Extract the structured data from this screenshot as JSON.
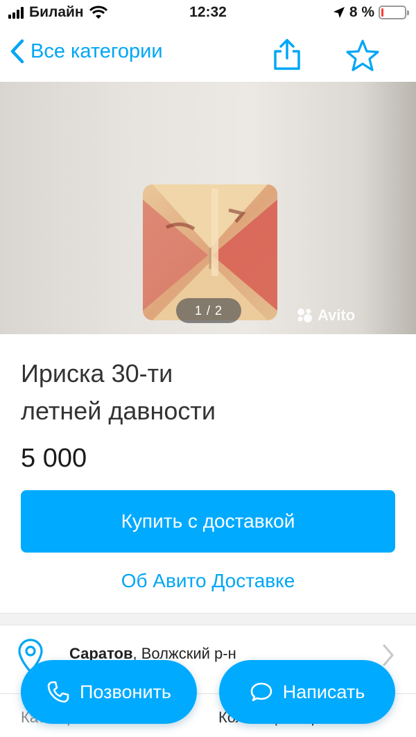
{
  "status_bar": {
    "carrier": "Билайн",
    "time": "12:32",
    "battery_percent": "8 %",
    "battery_level": 0.08
  },
  "nav": {
    "back_label": "Все категории",
    "accent_color": "#00a6f5"
  },
  "photo": {
    "counter": "1 / 2",
    "watermark": "Avito"
  },
  "listing": {
    "title_line1": "Ириска 30-ти",
    "title_line2": "летней давности",
    "price": "5 000"
  },
  "actions": {
    "buy_label": "Купить с доставкой",
    "about_delivery_label": "Об Авито Доставке",
    "call_label": "Позвонить",
    "write_label": "Написать",
    "primary_color": "#00aaff"
  },
  "location": {
    "city": "Саратов",
    "district": ", Волжский р-н"
  },
  "params": {
    "category_label": "Категория",
    "category_value": "Коллекционирование"
  }
}
